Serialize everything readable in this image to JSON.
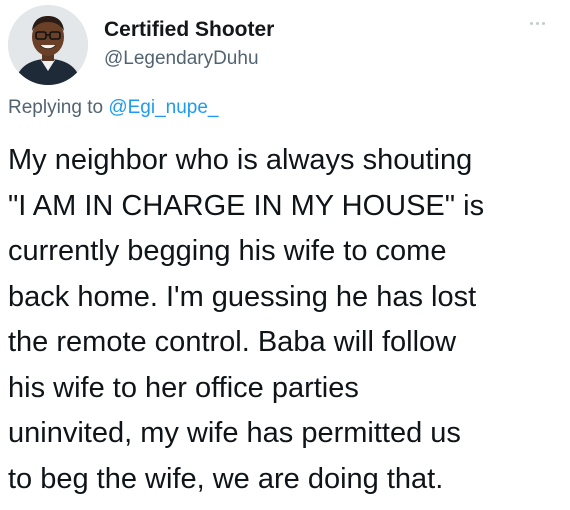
{
  "author": {
    "display_name": "Certified Shooter",
    "handle": "@LegendaryDuhu",
    "avatar": "profile-photo"
  },
  "menu": {
    "icon": "more-horizontal-icon"
  },
  "reply": {
    "prefix": "Replying to",
    "target": "@Egi_nupe_"
  },
  "tweet": {
    "lines": [
      "My neighbor who is always shouting",
      "\"I AM IN CHARGE IN MY HOUSE\" is",
      "currently begging his wife to come",
      "back home. I'm guessing he has lost",
      "the remote control. Baba will follow",
      "his wife to her office parties",
      "uninvited, my wife has permitted us",
      "to beg the wife, we are doing that."
    ]
  },
  "colors": {
    "link": "#1d9bf0",
    "secondary_text": "#536471",
    "primary_text": "#0f1419"
  }
}
